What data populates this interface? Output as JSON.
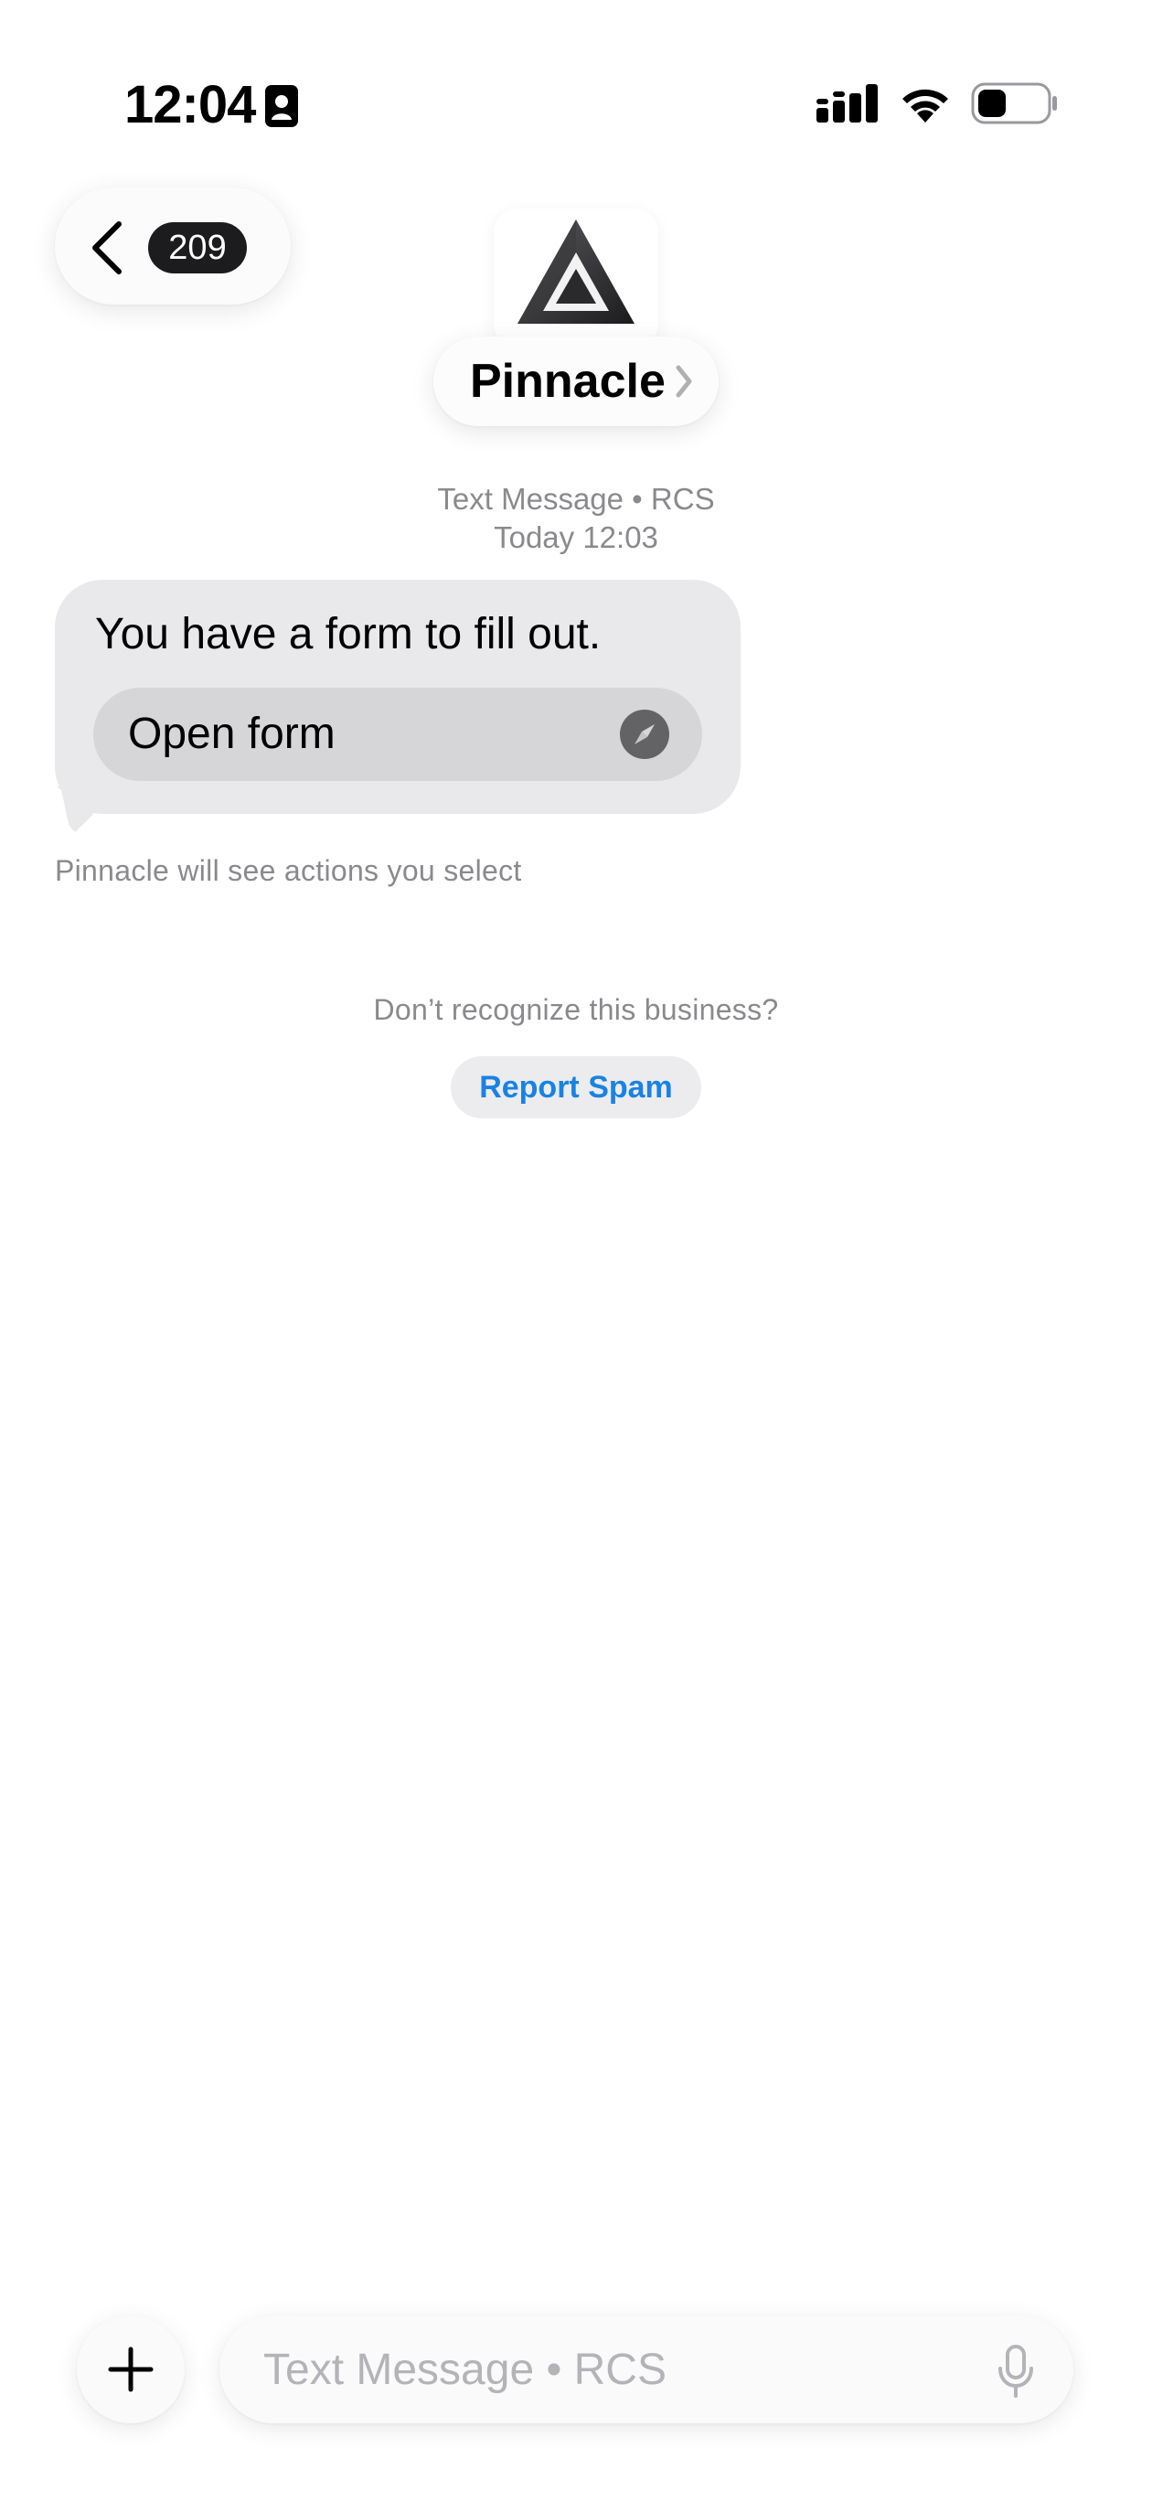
{
  "status_bar": {
    "time": "12:04"
  },
  "nav": {
    "unread_count": "209"
  },
  "business": {
    "name": "Pinnacle"
  },
  "thread": {
    "service": "Text Message • RCS",
    "timestamp": "Today 12:03"
  },
  "message": {
    "text": "You have a form to fill out.",
    "action_label": "Open form",
    "disclaimer": "Pinnacle will see actions you select"
  },
  "spam": {
    "prompt": "Don’t recognize this business?",
    "button_label": "Report Spam"
  },
  "compose": {
    "placeholder": "Text Message • RCS"
  },
  "colors": {
    "link_blue": "#1a82e2",
    "bubble_gray": "#e9e9eb",
    "badge_dark": "#1c1c1e"
  },
  "icons": [
    "contact-card-icon",
    "signal-icon",
    "wifi-icon",
    "battery-icon",
    "back-chevron-icon",
    "chevron-right-icon",
    "compass-icon",
    "plus-icon",
    "microphone-icon"
  ]
}
